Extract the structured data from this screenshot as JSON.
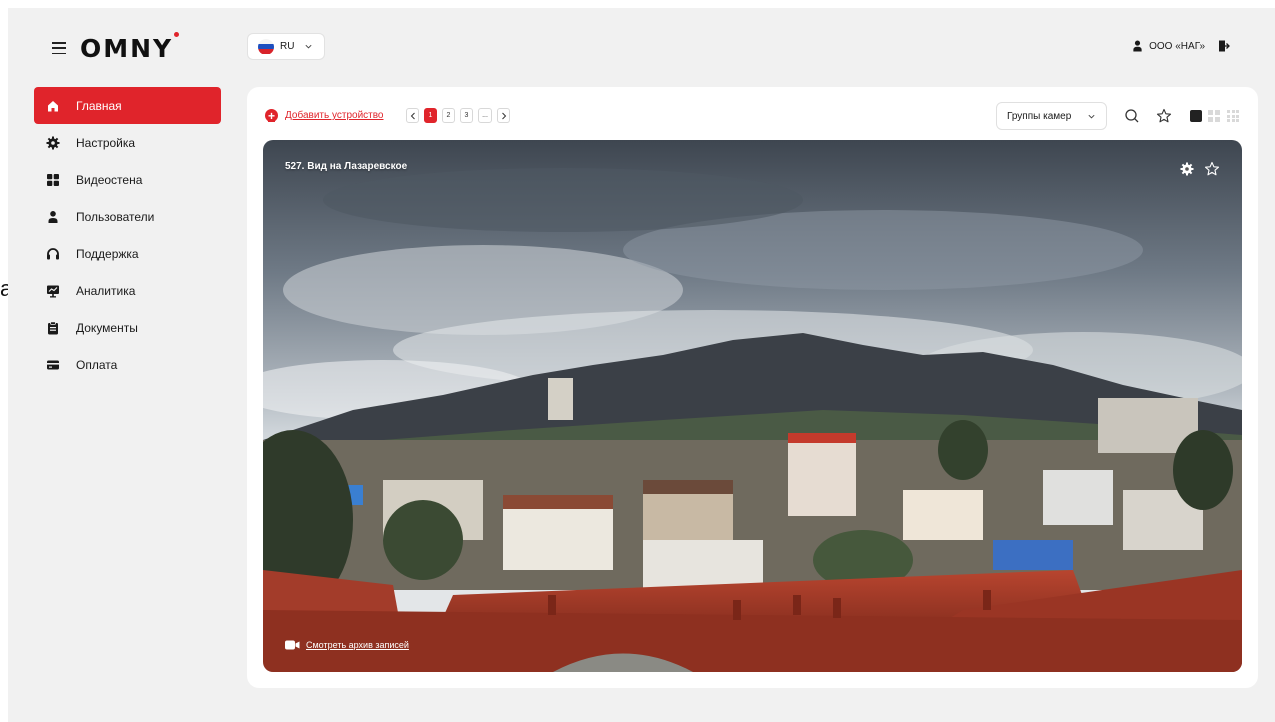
{
  "app": {
    "logo": "OMNY",
    "edge_glyph": "a"
  },
  "sidebar": {
    "items": [
      {
        "label": "Главная",
        "icon": "home-icon",
        "active": true
      },
      {
        "label": "Настройка",
        "icon": "gear-icon",
        "active": false
      },
      {
        "label": "Видеостена",
        "icon": "grid-icon",
        "active": false
      },
      {
        "label": "Пользователи",
        "icon": "user-icon",
        "active": false
      },
      {
        "label": "Поддержка",
        "icon": "headset-icon",
        "active": false
      },
      {
        "label": "Аналитика",
        "icon": "analytics-icon",
        "active": false
      },
      {
        "label": "Документы",
        "icon": "document-icon",
        "active": false
      },
      {
        "label": "Оплата",
        "icon": "card-icon",
        "active": false
      }
    ]
  },
  "topbar": {
    "language": "RU",
    "account_name": "ООО «НАГ»"
  },
  "toolbar": {
    "add_device": "Добавить устройство",
    "pages": [
      "1",
      "2",
      "3",
      "..."
    ],
    "current_page": "1",
    "camera_groups": "Группы камер"
  },
  "camera": {
    "title": "527. Вид на Лазаревское",
    "archive_link": "Смотреть архив записей"
  },
  "colors": {
    "accent": "#e0242b",
    "background": "#f1f1f1",
    "panel": "#ffffff"
  }
}
